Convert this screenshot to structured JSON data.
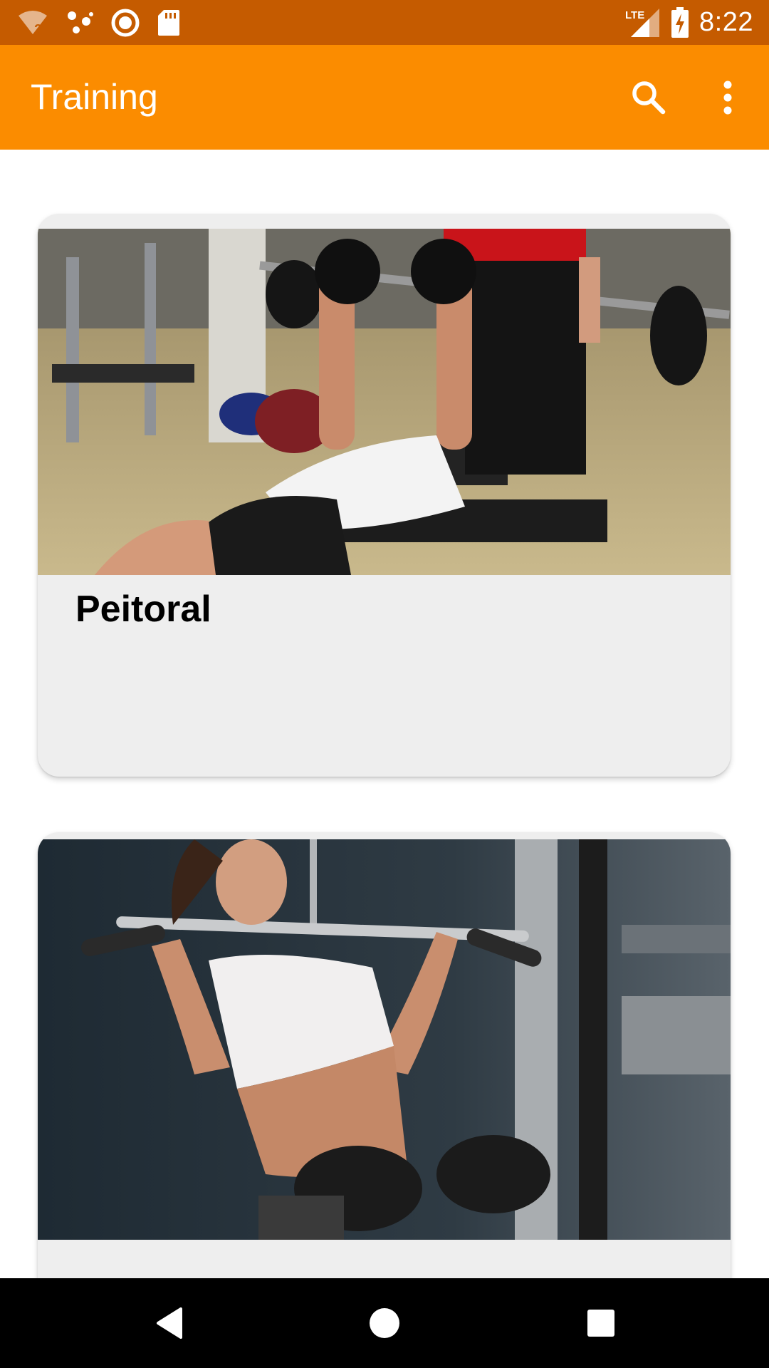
{
  "status_bar": {
    "time": "8:22",
    "network_label": "LTE",
    "icons": [
      "wifi-question-icon",
      "dots-icon",
      "record-icon",
      "sd-card-icon",
      "signal-icon",
      "battery-charging-icon"
    ]
  },
  "app_bar": {
    "title": "Training",
    "actions": [
      "search-icon",
      "more-vert-icon"
    ]
  },
  "cards": [
    {
      "title": "Peitoral",
      "image": "bench-press-photo"
    },
    {
      "title": "",
      "image": "lat-pulldown-photo"
    }
  ],
  "nav_bar": {
    "buttons": [
      "back-icon",
      "home-icon",
      "recents-icon"
    ]
  },
  "colors": {
    "status_bar": "#c55b00",
    "app_bar": "#fb8c00",
    "card_background": "#eeeeee",
    "nav_bar": "#000000"
  }
}
